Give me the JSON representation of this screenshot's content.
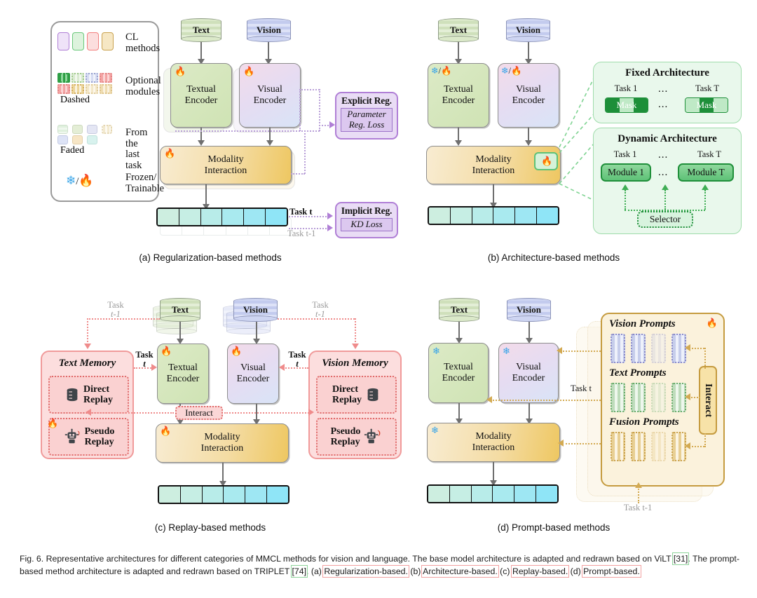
{
  "figure": {
    "caption_prefix": "Fig. 6.",
    "caption": "Representative architectures for different categories of MMCL methods for vision and language. The base model architecture is adapted and redrawn based on ViLT [31]. The prompt-based method architecture is adapted and redrawn based on TRIPLET [74]. (a) Regularization-based. (b) Architecture-based. (c) Replay-based. (d) Prompt-based.",
    "caption_parts": {
      "p1": "Representative architectures for different categories of MMCL methods for vision and language. The base model architecture is adapted and redrawn based on ViLT ",
      "ref1": "[31]",
      "p2": ". The prompt-based method architecture is adapted and redrawn based on TRIPLET ",
      "ref2": "[74]",
      "p3": ". (a) ",
      "hl1": "Regularization-based.",
      "p4": " (b) ",
      "hl2": "Architecture-based.",
      "p5": " (c) ",
      "hl3": "Replay-based.",
      "p6": " (d) ",
      "hl4": "Prompt-based."
    }
  },
  "legend": {
    "rows": [
      {
        "id": "cl-methods",
        "label": "CL\nmethods",
        "label_line1": "CL",
        "label_line2": "methods",
        "swatches": [
          "#efe3f8",
          "#ddf3dd",
          "#fcdede",
          "#f6e7c4"
        ],
        "borders": [
          "#b07fd6",
          "#6ac87a",
          "#f2807f",
          "#c9a24e"
        ]
      },
      {
        "id": "optional-modules",
        "label_line1": "Optional",
        "label_line2": "modules",
        "style_note": "Dashed",
        "colors_row1": [
          "#2e9e45",
          "#dff0d8",
          "#dfe4f5",
          "#f6b8b8"
        ],
        "colors_row2": [
          "#f6b8b8",
          "#f0dcae",
          "#f3ead0",
          "#efdcb0"
        ]
      },
      {
        "id": "from-last-task",
        "label_line1": "From the",
        "label_line2": "last task",
        "style_note": "Faded",
        "colors_row1": [
          "#dff0dd",
          "#e4eed6",
          "#e4e6f4",
          "#faf4e3"
        ],
        "colors_row2": [
          "#dde3f6",
          "#f7e6c6",
          "#d8f2ee"
        ]
      },
      {
        "id": "frozen-trainable",
        "label_line1": "Frozen/",
        "label_line2": "Trainable",
        "icons": [
          "snowflake-icon",
          "flame-icon"
        ],
        "separator": "/"
      }
    ]
  },
  "common": {
    "text_source": "Text",
    "vision_source": "Vision",
    "textual_encoder_l1": "Textual",
    "textual_encoder_l2": "Encoder",
    "visual_encoder_l1": "Visual",
    "visual_encoder_l2": "Encoder",
    "modality_l1": "Modality",
    "modality_l2": "Interaction",
    "task_t": "Task t",
    "task_t1": "Task t-1",
    "task_word": "Task",
    "t_italic": "t",
    "t1_italic": "t-1"
  },
  "panels": {
    "a": {
      "caption": "(a) Regularization-based methods",
      "explicit": {
        "title": "Explicit Reg.",
        "inner_l1": "Parameter",
        "inner_l2": "Reg. Loss"
      },
      "implicit": {
        "title": "Implicit Reg.",
        "inner_l1": "KD Loss"
      },
      "task_t": "Task t",
      "task_t1": "Task t-1"
    },
    "b": {
      "caption": "(b) Architecture-based methods",
      "fixed": {
        "title": "Fixed Architecture",
        "task_first": "Task 1",
        "task_last": "Task T",
        "ellipsis": "...",
        "mask_label": "Mask"
      },
      "dynamic": {
        "title": "Dynamic Architecture",
        "task_first": "Task 1",
        "task_last": "Task T",
        "ellipsis": "...",
        "module_first": "Module 1",
        "module_last": "Module T",
        "selector": "Selector"
      }
    },
    "c": {
      "caption": "(c) Replay-based methods",
      "text_memory": {
        "title": "Text Memory",
        "direct_l1": "Direct",
        "direct_l2": "Replay",
        "pseudo_l1": "Pseudo",
        "pseudo_l2": "Replay"
      },
      "vision_memory": {
        "title": "Vision Memory",
        "direct_l1": "Direct",
        "direct_l2": "Replay",
        "pseudo_l1": "Pseudo",
        "pseudo_l2": "Replay"
      },
      "interact": "Interact",
      "task_t": "Task t",
      "task_t_word": "Task",
      "task_t1_word": "Task",
      "task_t1_sub": "t-1"
    },
    "d": {
      "caption": "(d) Prompt-based methods",
      "vision_prompts": "Vision Prompts",
      "text_prompts": "Text Prompts",
      "fusion_prompts": "Fusion Prompts",
      "interact": "Interact",
      "task_t": "Task t",
      "task_t1": "Task t-1"
    }
  },
  "colors": {
    "text_green": "#cfe3b4",
    "vision_blue": "#ced5f2",
    "modality_gold": "#eec761",
    "reg_purple": "#b07fd6",
    "arch_green": "#1f8f3a",
    "replay_red": "#f09a9a",
    "prompt_gold": "#c59b3f",
    "arrow_grey": "#6f6f6f"
  },
  "icons": {
    "flame": "🔥",
    "snowflake": "❄",
    "database": "database-icon",
    "robot": "robot-icon"
  }
}
